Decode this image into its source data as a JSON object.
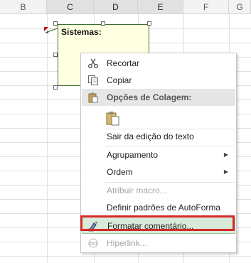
{
  "columns": [
    "B",
    "C",
    "D",
    "E",
    "F",
    "G"
  ],
  "comment": {
    "text": "Sistemas:"
  },
  "menu": {
    "items": [
      {
        "label": "Recortar",
        "icon": "scissors-icon"
      },
      {
        "label": "Copiar",
        "icon": "copy-icon"
      },
      {
        "label": "Opções de Colagem:",
        "icon": "paste-options-icon"
      },
      {
        "label": "Sair da edição do texto"
      },
      {
        "label": "Agrupamento"
      },
      {
        "label": "Ordem"
      },
      {
        "label": "Atribuir macro..."
      },
      {
        "label": "Definir padrões de AutoForma"
      },
      {
        "label": "Formatar comentário...",
        "icon": "format-comment-icon"
      },
      {
        "label": "Hiperlink...",
        "icon": "hyperlink-icon"
      }
    ]
  },
  "colors": {
    "highlight_border": "#d42a2a",
    "comment_bg": "#ffffe1"
  }
}
